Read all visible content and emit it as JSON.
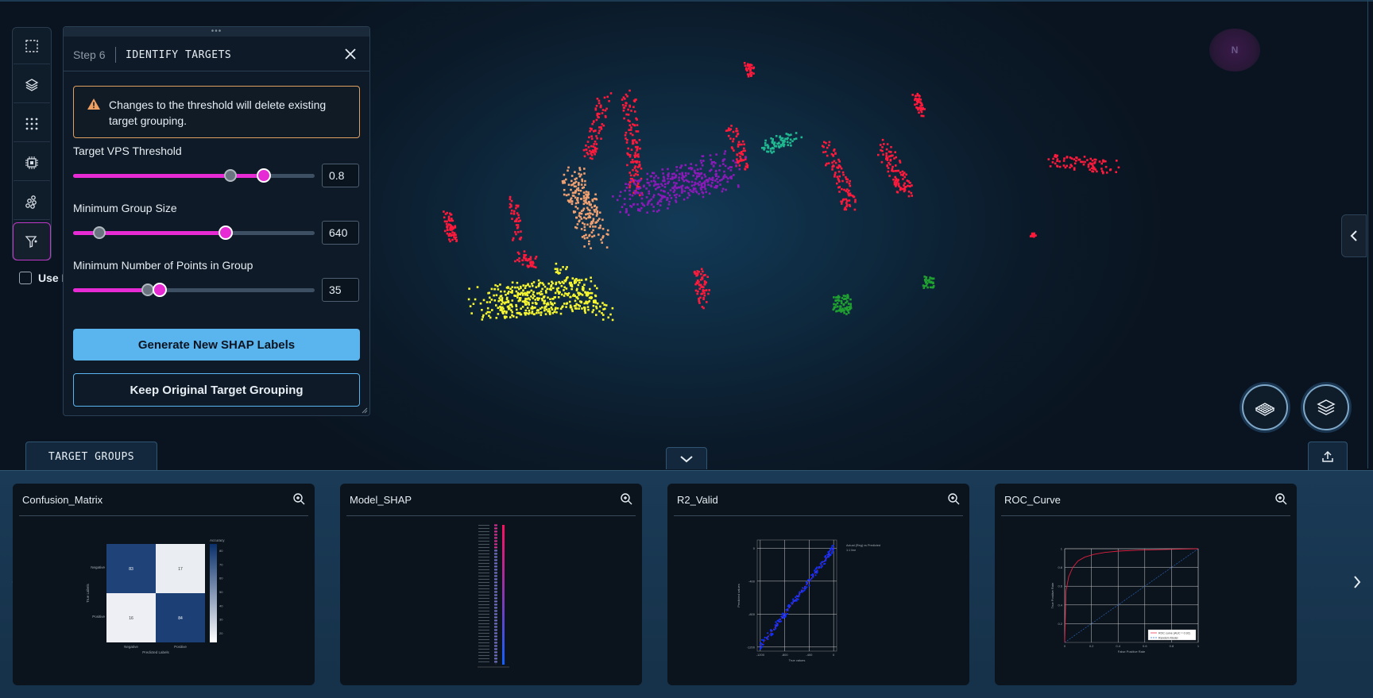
{
  "panel": {
    "step_label": "Step 6",
    "title": "IDENTIFY TARGETS",
    "warning": "Changes to the threshold will delete existing target grouping.",
    "sliders": [
      {
        "label": "Target VPS Threshold",
        "value": "0.8",
        "fraction": 0.79,
        "ghost_fraction": 0.65
      },
      {
        "label": "Minimum Group Size",
        "value": "640",
        "fraction": 0.63,
        "ghost_fraction": 0.11
      },
      {
        "label": "Minimum Number of Points in Group",
        "value": "35",
        "fraction": 0.36,
        "ghost_fraction": 0.31
      }
    ],
    "primary_button": "Generate New SHAP Labels",
    "secondary_button": "Keep Original Target Grouping"
  },
  "checkbox": {
    "label": "Use New GenVPS",
    "checked": false
  },
  "toolbar": {
    "items": [
      "select-box-icon",
      "layers-icon",
      "grid-dots-icon",
      "chip-icon",
      "cluster-icon",
      "filter-icon"
    ],
    "active_index": 5
  },
  "compass": {
    "text": "N"
  },
  "dock": {
    "tab_label": "TARGET GROUPS",
    "cards": [
      {
        "title": "Confusion_Matrix"
      },
      {
        "title": "Model_SHAP"
      },
      {
        "title": "R2_Valid"
      },
      {
        "title": "ROC_Curve"
      }
    ]
  },
  "chart_data": [
    {
      "type": "heatmap",
      "title": "",
      "xlabel": "Predicted Labels",
      "ylabel": "True Labels",
      "x_categories": [
        "Negative",
        "Positive"
      ],
      "y_categories": [
        "Negative",
        "Positive"
      ],
      "values": [
        [
          83,
          17
        ],
        [
          16,
          84
        ]
      ],
      "colorbar_label": "Accuracy",
      "colorbar_ticks": [
        "80",
        "70",
        "60",
        "50",
        "40",
        "30",
        "20"
      ]
    },
    {
      "type": "scatter",
      "title": "",
      "series": [
        {
          "name": "Actual (Reg) vs Predicted",
          "x": [
            -1200,
            -1100,
            -1000,
            -900,
            -800,
            -700,
            -600,
            -500,
            -400,
            -300,
            -200,
            -100,
            -50,
            0
          ],
          "y": [
            -1180,
            -1090,
            -1010,
            -880,
            -810,
            -690,
            -610,
            -490,
            -410,
            -290,
            -210,
            -100,
            -40,
            0
          ]
        },
        {
          "name": "1:1 line",
          "x": [
            -1200,
            0
          ],
          "y": [
            -1200,
            0
          ]
        }
      ],
      "xlabel": "True values",
      "ylabel": "Predicted values",
      "xlim": [
        -1250,
        50
      ],
      "ylim": [
        -1250,
        100
      ],
      "x_ticks": [
        "-1200",
        "-800",
        "-400",
        "0"
      ],
      "y_ticks": [
        "0",
        "-400",
        "-800",
        "-1200"
      ]
    },
    {
      "type": "line",
      "title": "",
      "series": [
        {
          "name": "ROC curve (AUC = 0.92)",
          "x": [
            0,
            0.01,
            0.03,
            0.06,
            0.1,
            0.15,
            0.22,
            0.3,
            0.4,
            0.55,
            0.7,
            0.85,
            1.0
          ],
          "y": [
            0,
            0.55,
            0.7,
            0.8,
            0.87,
            0.91,
            0.94,
            0.96,
            0.975,
            0.985,
            0.99,
            0.995,
            1.0
          ]
        },
        {
          "name": "Random Model",
          "x": [
            0,
            1
          ],
          "y": [
            0,
            1
          ]
        }
      ],
      "xlabel": "False Positive Rate",
      "ylabel": "True Positive Rate",
      "xlim": [
        0,
        1
      ],
      "ylim": [
        0,
        1
      ],
      "x_ticks": [
        "0",
        "0.2",
        "0.4",
        "0.6",
        "0.8",
        "1"
      ],
      "y_ticks": [
        "1",
        "0.8",
        "0.6",
        "0.4",
        "0.2"
      ]
    }
  ],
  "colors": {
    "accent": "#e62bd4",
    "primary_button": "#5ab4ee",
    "warning_border": "#e0a060",
    "cluster_red": "#ff1a3c",
    "cluster_orange": "#f0a070",
    "cluster_purple": "#8a1ab8",
    "cluster_teal": "#20b890",
    "cluster_yellow": "#f5f530",
    "cluster_green": "#20a030"
  }
}
